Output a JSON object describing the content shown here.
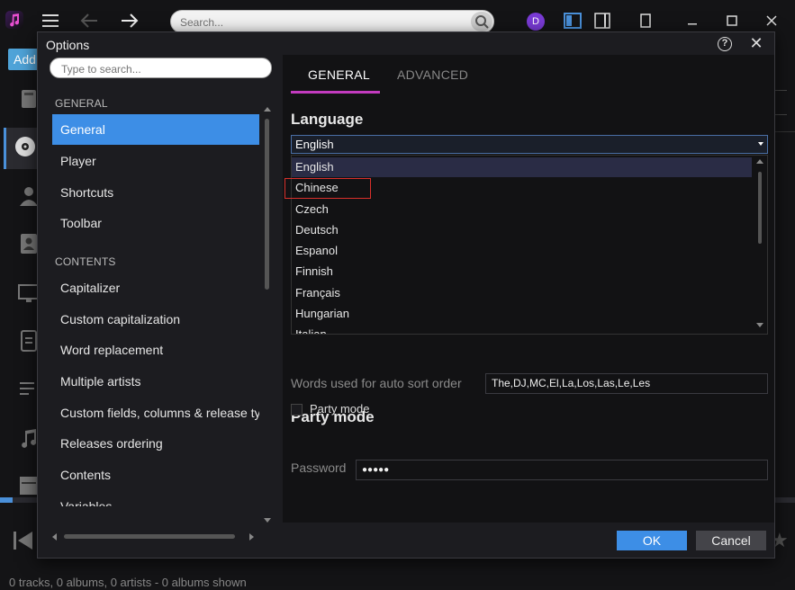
{
  "app": {
    "search_placeholder": "Search...",
    "avatar_initial": "D",
    "add_label": "Add",
    "status": "0 tracks, 0 albums, 0 artists - 0 albums shown"
  },
  "dialog": {
    "title": "Options",
    "help": "?",
    "close": "✕",
    "search_placeholder": "Type to search...",
    "nav": {
      "general_header": "GENERAL",
      "general_items": [
        "General",
        "Player",
        "Shortcuts",
        "Toolbar"
      ],
      "selected": "General",
      "contents_header": "CONTENTS",
      "contents_items": [
        "Capitalizer",
        "Custom capitalization",
        "Word replacement",
        "Multiple artists",
        "Custom fields, columns & release ty",
        "Releases ordering",
        "Contents",
        "Variables"
      ]
    },
    "tabs": {
      "general": "GENERAL",
      "advanced": "ADVANCED",
      "active": "GENERAL"
    },
    "language": {
      "title": "Language",
      "selected": "English",
      "options": [
        "English",
        "Chinese",
        "Czech",
        "Deutsch",
        "Espanol",
        "Finnish",
        "Français",
        "Hungarian",
        "Italian"
      ],
      "highlighted": "Chinese"
    },
    "sort": {
      "label": "Words used for auto sort order",
      "value": "The,DJ,MC,El,La,Los,Las,Le,Les"
    },
    "party": {
      "title": "Party mode",
      "checkbox_label": "Party mode",
      "checked": false,
      "password_label": "Password",
      "password_value": "●●●●●"
    },
    "buttons": {
      "ok": "OK",
      "cancel": "Cancel"
    }
  },
  "colors": {
    "accent": "#3d8ee6",
    "tab_underline": "#c33bbf",
    "highlight_box": "#d9302b"
  }
}
